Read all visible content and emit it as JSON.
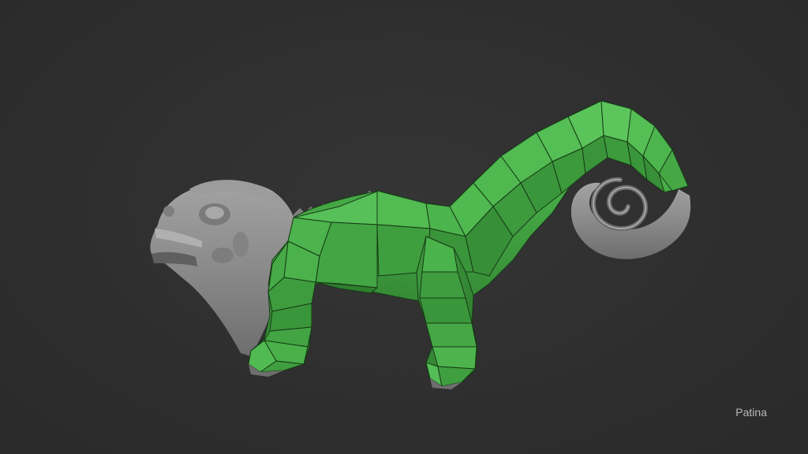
{
  "viewport": {
    "background_color": "#2e2e2e",
    "watermark": "Patina"
  },
  "model": {
    "icon": "chameleon-sculpt",
    "sculpt_color": "#8e8e8e",
    "retopology_color": "#49b04a",
    "wire_color": "#163a16"
  }
}
